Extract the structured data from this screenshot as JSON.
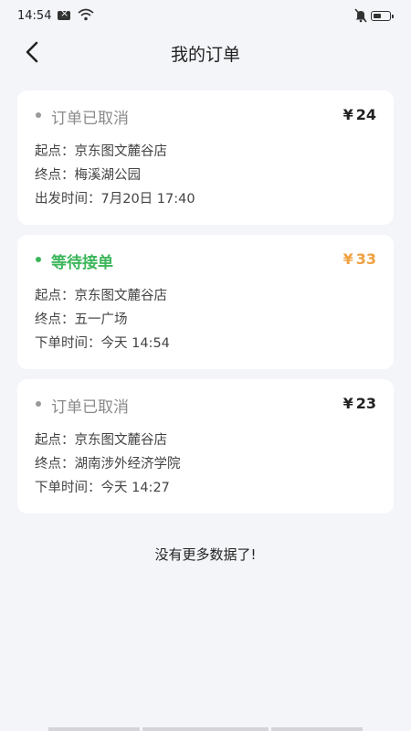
{
  "status_bar": {
    "time": "14:54"
  },
  "nav": {
    "title": "我的订单"
  },
  "orders": [
    {
      "status": "订单已取消",
      "currency": "¥",
      "price": "24",
      "origin_label": "起点：",
      "origin": "京东图文麓谷店",
      "dest_label": "终点：",
      "dest": "梅溪湖公园",
      "time_label": "出发时间：",
      "time": "7月20日 17:40"
    },
    {
      "status": "等待接单",
      "currency": "¥",
      "price": "33",
      "origin_label": "起点：",
      "origin": "京东图文麓谷店",
      "dest_label": "终点：",
      "dest": "五一广场",
      "time_label": "下单时间：",
      "time": "今天 14:54"
    },
    {
      "status": "订单已取消",
      "currency": "¥",
      "price": "23",
      "origin_label": "起点：",
      "origin": "京东图文麓谷店",
      "dest_label": "终点：",
      "dest": "湖南涉外经济学院",
      "time_label": "下单时间：",
      "time": "今天 14:27"
    }
  ],
  "footer": {
    "no_more": "没有更多数据了!"
  },
  "colors": {
    "active": "#3bb65a",
    "active_price": "#f0a040",
    "cancelled": "#8a8a8a",
    "background": "#f4f5f9"
  },
  "icons": [
    "notification-icon",
    "wifi-icon",
    "mute-bell-icon",
    "battery-icon",
    "back-arrow-icon"
  ]
}
